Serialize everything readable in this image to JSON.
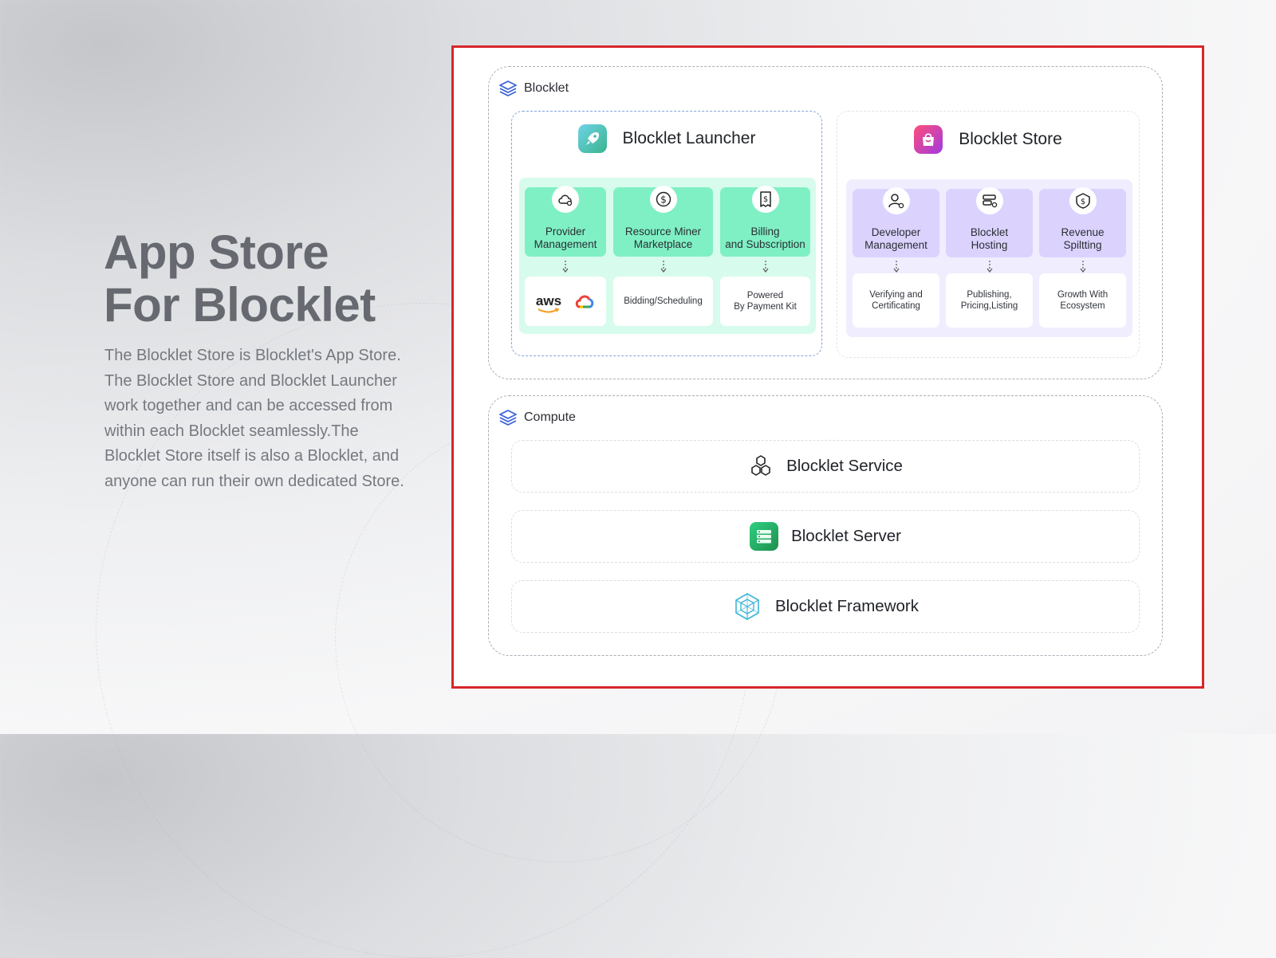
{
  "hero": {
    "title_line1": "App Store",
    "title_line2": "For Blocklet",
    "description_lines": [
      "The Blocklet Store is Blocklet's App Store.",
      "The Blocklet Store and Blocklet Launcher",
      "work together and can be accessed from",
      "within each Blocklet seamlessly.The",
      "Blocklet Store itself is also a Blocklet, and",
      "anyone can run their own dedicated Store."
    ]
  },
  "blocklet_section": {
    "label": "Blocklet",
    "icon": "layers-icon",
    "launcher": {
      "title": "Blocklet Launcher",
      "icon": "rocket-icon",
      "accent": "#7ff0c4",
      "area_color": "#d7fbec",
      "columns": [
        {
          "label_line1": "Provider",
          "label_line2": "Management",
          "icon": "cloud-gear-icon",
          "card_line1": "aws",
          "card_line2": "",
          "card_icon": "google-cloud-icon"
        },
        {
          "label_line1": "Resource Miner",
          "label_line2": "Marketplace",
          "icon": "dollar-coin-icon",
          "card_line1": "Bidding/Scheduling",
          "card_line2": ""
        },
        {
          "label_line1": "Billing",
          "label_line2": "and Subscription",
          "icon": "receipt-icon",
          "card_line1": "Powered",
          "card_line2": "By Payment Kit"
        }
      ]
    },
    "store": {
      "title": "Blocklet Store",
      "icon": "shopping-bag-icon",
      "accent": "#dbd3fe",
      "area_color": "#f0edfe",
      "columns": [
        {
          "label_line1": "Developer",
          "label_line2": "Management",
          "icon": "user-gear-icon",
          "card_line1": "Verifying and",
          "card_line2": "Certificating"
        },
        {
          "label_line1": "Blocklet",
          "label_line2": "Hosting",
          "icon": "server-gear-icon",
          "card_line1": "Publishing,",
          "card_line2": "Pricing,Listing"
        },
        {
          "label_line1": "Revenue",
          "label_line2": "Spiltting",
          "icon": "dollar-shield-icon",
          "card_line1": "Growth With",
          "card_line2": "Ecosystem"
        }
      ]
    }
  },
  "compute_section": {
    "label": "Compute",
    "icon": "layers-icon",
    "rows": [
      {
        "label": "Blocklet Service",
        "icon": "hexagons-icon"
      },
      {
        "label": "Blocklet Server",
        "icon": "server-stack-icon"
      },
      {
        "label": "Blocklet Framework",
        "icon": "framework-cube-icon"
      }
    ]
  },
  "colors": {
    "frame_border": "#d7262b",
    "section_border": "#a9aeb6",
    "launcher_border": "#7fa3dc",
    "store_border": "#e2e4e8",
    "layers_icon": "#3b63d9"
  }
}
